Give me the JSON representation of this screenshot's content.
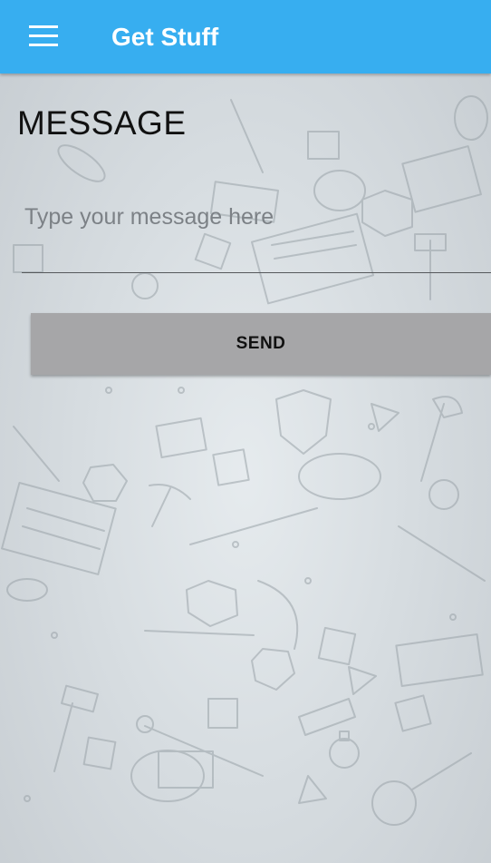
{
  "appbar": {
    "title": "Get Stuff",
    "menu_icon": "hamburger-menu-icon",
    "background": "#37aef0"
  },
  "main": {
    "section_title": "MESSAGE",
    "message_input": {
      "placeholder": "Type your message here",
      "value": ""
    },
    "send_button": {
      "label": "SEND",
      "background": "#a6a6a8"
    }
  },
  "background": {
    "pattern": "fantasy-rpg-doodle-pattern",
    "color": "#d7dde1"
  }
}
